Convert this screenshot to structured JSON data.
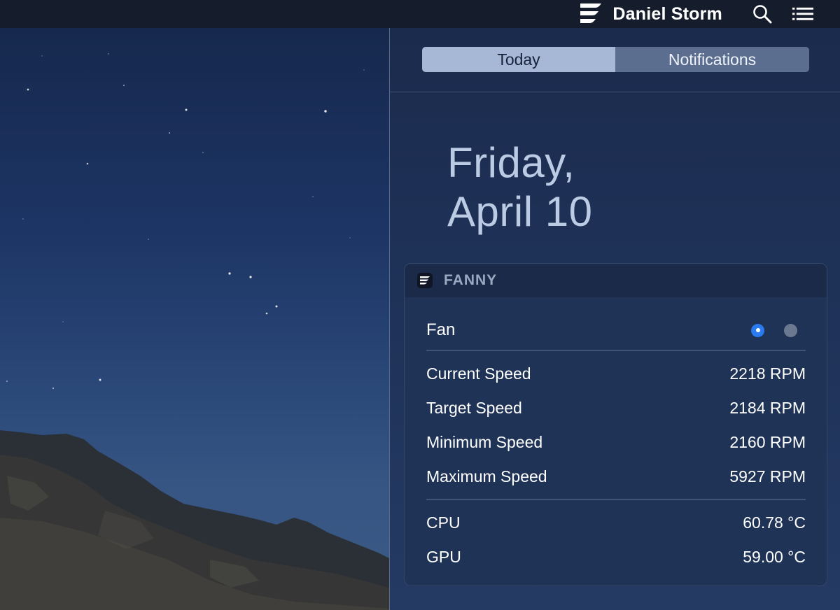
{
  "menubar": {
    "app_icon": "fanny-logo-icon",
    "user_name": "Daniel Storm",
    "search_icon": "search-icon",
    "list_icon": "notification-list-icon"
  },
  "notification_center": {
    "tabs": [
      {
        "label": "Today",
        "active": true
      },
      {
        "label": "Notifications",
        "active": false
      }
    ],
    "date": {
      "weekday": "Friday,",
      "day": "April 10"
    },
    "widget": {
      "title": "FANNY",
      "fan_label": "Fan",
      "fan_selected_index": 0,
      "fan_count": 2,
      "speeds": [
        {
          "label": "Current Speed",
          "value": "2218 RPM"
        },
        {
          "label": "Target Speed",
          "value": "2184 RPM"
        },
        {
          "label": "Minimum Speed",
          "value": "2160 RPM"
        },
        {
          "label": "Maximum Speed",
          "value": "5927 RPM"
        }
      ],
      "temperatures": [
        {
          "label": "CPU",
          "value": "60.78 °C"
        },
        {
          "label": "GPU",
          "value": "59.00 °C"
        }
      ]
    }
  },
  "colors": {
    "menubar_bg": "#151c2b",
    "panel_bg": "#1e3157",
    "widget_bg": "#1f3356",
    "radio_selected": "#2a7bf0",
    "tab_active_bg": "#a7b7d6",
    "tab_inactive_bg": "#5c6e90"
  }
}
